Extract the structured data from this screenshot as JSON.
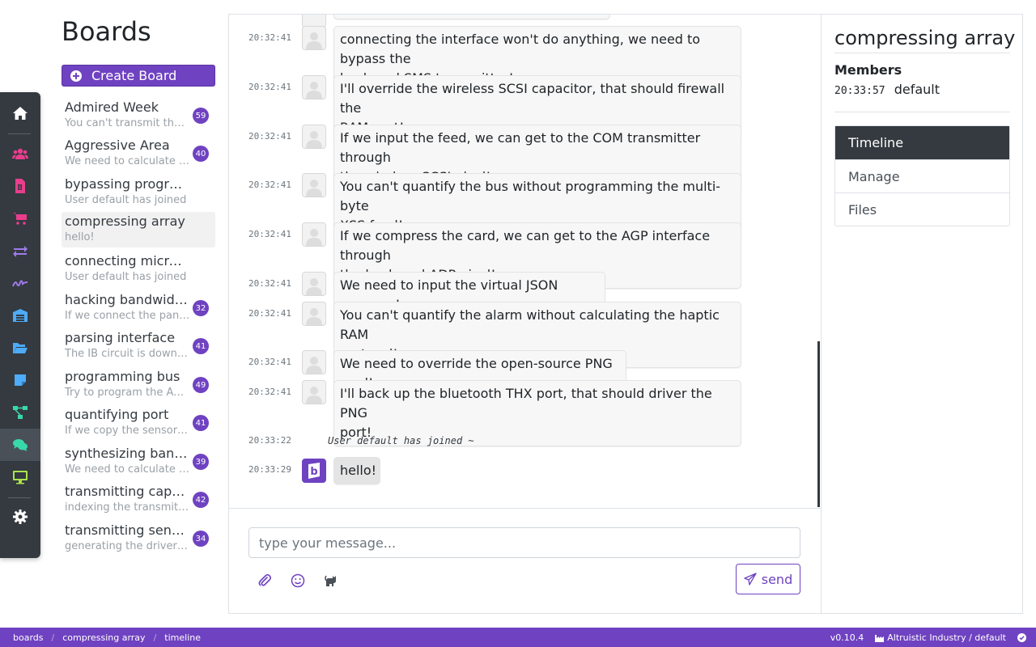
{
  "sidebar_rail": {
    "items": [
      {
        "icon": "home-icon",
        "color": "#ffffff",
        "active": false
      },
      {
        "icon": "users-icon",
        "color": "#e83e8c",
        "active": false
      },
      {
        "icon": "invoice-icon",
        "color": "#e83e8c",
        "active": false
      },
      {
        "icon": "cart-icon",
        "color": "#e83e8c",
        "active": false
      },
      {
        "icon": "exchange-icon",
        "color": "#9f7aea",
        "active": false
      },
      {
        "icon": "signature-icon",
        "color": "#9f7aea",
        "active": false
      },
      {
        "icon": "warehouse-icon",
        "color": "#4dabf7",
        "active": false
      },
      {
        "icon": "folder-open-icon",
        "color": "#4dabf7",
        "active": false
      },
      {
        "icon": "sticky-note-icon",
        "color": "#4dabf7",
        "active": false
      },
      {
        "icon": "project-diagram-icon",
        "color": "#38d9a9",
        "active": false
      },
      {
        "icon": "comments-icon",
        "color": "#38d9a9",
        "active": true
      },
      {
        "icon": "desktop-icon",
        "color": "#a9e34b",
        "active": false
      },
      {
        "icon": "gear-icon",
        "color": "#ffffff",
        "active": false
      }
    ]
  },
  "boards": {
    "title": "Boards",
    "create_label": "Create Board",
    "items": [
      {
        "name": "Admired Week",
        "preview": "You can't transmit the array without parsing the virtual PCI panel!",
        "badge": "59"
      },
      {
        "name": "Aggressive Area",
        "preview": "We need to calculate the cross-platform GB program!",
        "badge": "40"
      },
      {
        "name": "bypassing program",
        "preview": "User default has joined",
        "badge": ""
      },
      {
        "name": "compressing array",
        "preview": "hello!",
        "badge": ""
      },
      {
        "name": "connecting microchip",
        "preview": "User default has joined",
        "badge": ""
      },
      {
        "name": "hacking bandwidth",
        "preview": "If we connect the panel, we can get to the HDD port!",
        "badge": "32"
      },
      {
        "name": "parsing interface",
        "preview": "The IB circuit is down, quantify the solid state alarm!",
        "badge": "41"
      },
      {
        "name": "programming bus",
        "preview": "Try to program the AGP system, maybe it will bypass the port!",
        "badge": "49"
      },
      {
        "name": "quantifying port",
        "preview": "If we copy the sensor, we can get to the SSL pixel!",
        "badge": "41"
      },
      {
        "name": "synthesizing bandwidth",
        "preview": "We need to calculate the neural SMS card!",
        "badge": "39"
      },
      {
        "name": "transmitting capacitor",
        "preview": "indexing the transmitter won't do anything!",
        "badge": "42"
      },
      {
        "name": "transmitting sensor",
        "preview": "generating the driver won't do anything!",
        "badge": "34"
      }
    ]
  },
  "chat": {
    "messages": [
      {
        "time": "20:32:41",
        "lines": [
          "connecting the interface won't do anything, we need to bypass the",
          "back-end SMS transmitter!"
        ]
      },
      {
        "time": "20:32:41",
        "lines": [
          "I'll override the wireless SCSI capacitor, that should firewall the",
          "RAM port!"
        ]
      },
      {
        "time": "20:32:41",
        "lines": [
          "If we input the feed, we can get to the COM transmitter through",
          "the wireless SCSI pixel!"
        ]
      },
      {
        "time": "20:32:41",
        "lines": [
          "You can't quantify the bus without programming the multi-byte",
          "XSS feed!"
        ]
      },
      {
        "time": "20:32:41",
        "lines": [
          "If we compress the card, we can get to the AGP interface through",
          "the back-end ADP pixel!"
        ]
      },
      {
        "time": "20:32:41",
        "lines": [
          "We need to input the virtual JSON program!"
        ]
      },
      {
        "time": "20:32:41",
        "lines": [
          "You can't quantify the alarm without calculating the haptic RAM",
          "protocol!"
        ]
      },
      {
        "time": "20:32:41",
        "lines": [
          "We need to override the open-source PNG card!"
        ]
      },
      {
        "time": "20:32:41",
        "lines": [
          "I'll back up the bluetooth THX port, that should driver the PNG",
          "port!"
        ]
      }
    ],
    "system_time": "20:33:22",
    "system_text": "User default has joined ~",
    "own_time": "20:33:29",
    "own_text": "hello!",
    "input_placeholder": "type your message...",
    "send_label": "send"
  },
  "details": {
    "title": "compressing array",
    "members_heading": "Members",
    "member_time": "20:33:57",
    "member_name": "default",
    "nav": [
      "Timeline",
      "Manage",
      "Files"
    ],
    "active_nav": "Timeline"
  },
  "footer": {
    "crumbs": [
      "boards",
      "compressing array",
      "timeline"
    ],
    "version": "v0.10.4",
    "org": "Altruistic Industry / default"
  },
  "colors": {
    "accent": "#6f42c1",
    "dark": "#343a40"
  }
}
